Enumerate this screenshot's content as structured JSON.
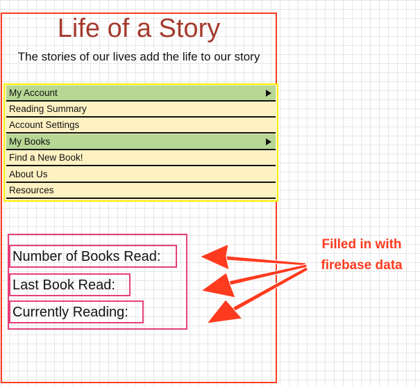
{
  "header": {
    "title": "Life of a Story",
    "tagline": "The stories of our lives add the life to our story"
  },
  "nav": {
    "items": [
      {
        "label": "My Account",
        "type": "parent",
        "has_submenu": true
      },
      {
        "label": "Reading Summary",
        "type": "child",
        "has_submenu": false
      },
      {
        "label": "Account Settings",
        "type": "child",
        "has_submenu": false
      },
      {
        "label": "My Books",
        "type": "parent",
        "has_submenu": true
      },
      {
        "label": "Find a New Book!",
        "type": "child",
        "has_submenu": false
      },
      {
        "label": "About Us",
        "type": "child",
        "has_submenu": false
      },
      {
        "label": "Resources",
        "type": "child",
        "has_submenu": false
      }
    ]
  },
  "stats": {
    "books_read_label": "Number of Books Read:",
    "last_book_label": "Last Book Read:",
    "currently_reading_label": "Currently Reading:"
  },
  "annotation": {
    "line1": "Filled in with",
    "line2": "firebase data"
  },
  "colors": {
    "frame": "#ff3b1f",
    "title": "#a53b2e",
    "menu_border": "#ffee00",
    "menu_parent": "#b7d795",
    "menu_child": "#fff2c2",
    "stats_border": "#e63e7a",
    "annotation": "#ff3b1f"
  }
}
